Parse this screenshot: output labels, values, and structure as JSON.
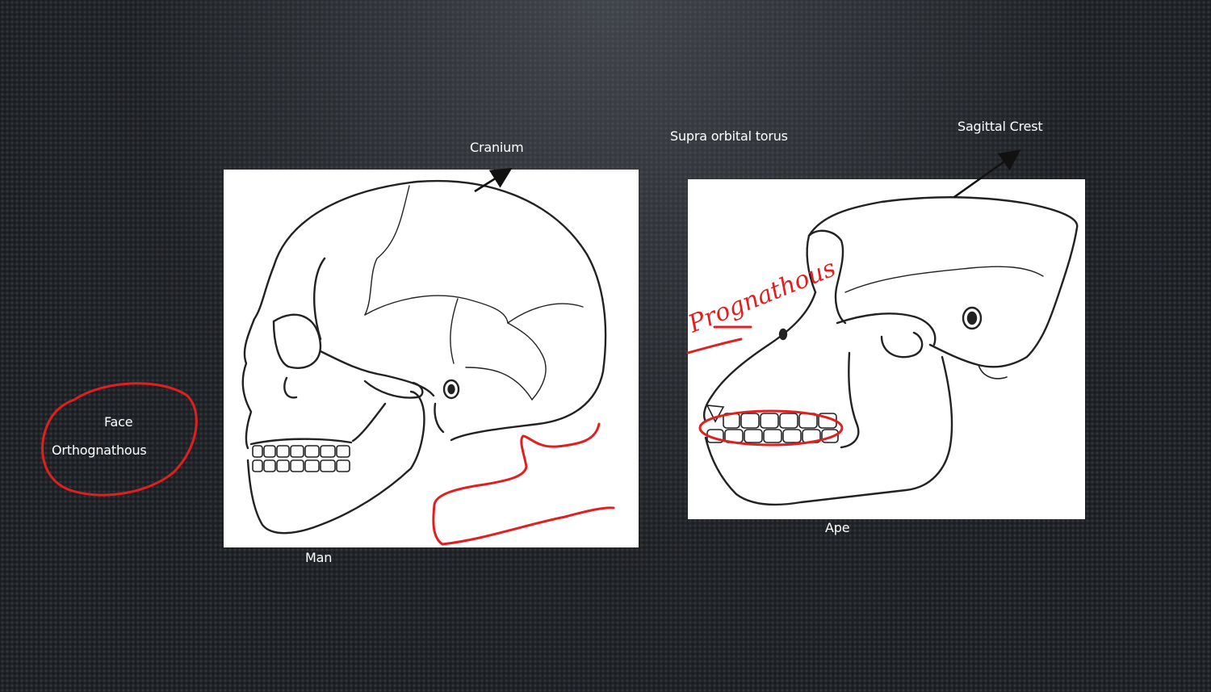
{
  "labels": {
    "cranium": "Cranium",
    "supra_orbital": "Supra orbital torus",
    "sagittal_crest": "Sagittal Crest",
    "face": "Face",
    "orthognathous": "Orthognathous",
    "man": "Man",
    "ape": "Ape"
  },
  "annotations": {
    "handwritten": "Prognathous"
  },
  "colors": {
    "ink": "#e02020",
    "line": "#222222",
    "label": "#ffffff"
  }
}
